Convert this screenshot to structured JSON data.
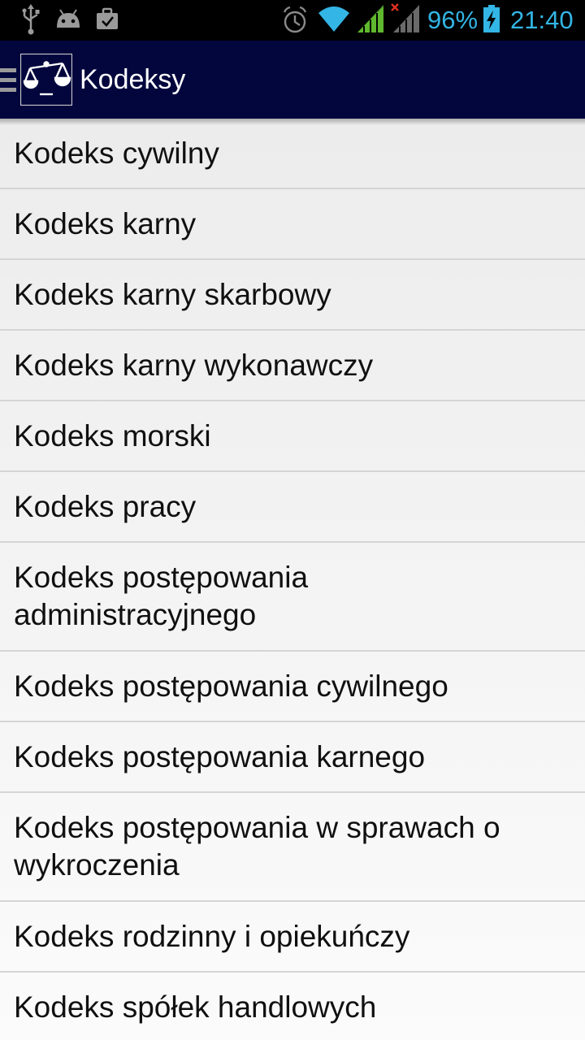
{
  "status_bar": {
    "battery_percent": "96%",
    "time": "21:40",
    "accent_color": "#33b5e5",
    "icons": [
      "usb-icon",
      "android-debug-icon",
      "briefcase-icon",
      "alarm-icon",
      "wifi-icon",
      "signal-icon",
      "signal-no-sim-icon",
      "battery-charging-icon"
    ]
  },
  "action_bar": {
    "title": "Kodeksy",
    "background": "#02063d",
    "icons": [
      "drawer-menu-icon",
      "scales-of-justice-icon"
    ]
  },
  "list": {
    "items": [
      {
        "label": "Kodeks cywilny"
      },
      {
        "label": "Kodeks karny"
      },
      {
        "label": "Kodeks karny skarbowy"
      },
      {
        "label": "Kodeks karny wykonawczy"
      },
      {
        "label": "Kodeks morski"
      },
      {
        "label": "Kodeks pracy"
      },
      {
        "label": "Kodeks postępowania administracyjnego"
      },
      {
        "label": "Kodeks postępowania cywilnego"
      },
      {
        "label": "Kodeks postępowania karnego"
      },
      {
        "label": "Kodeks postępowania w sprawach o wykroczenia"
      },
      {
        "label": "Kodeks rodzinny i opiekuńczy"
      },
      {
        "label": "Kodeks spółek handlowych"
      }
    ]
  }
}
